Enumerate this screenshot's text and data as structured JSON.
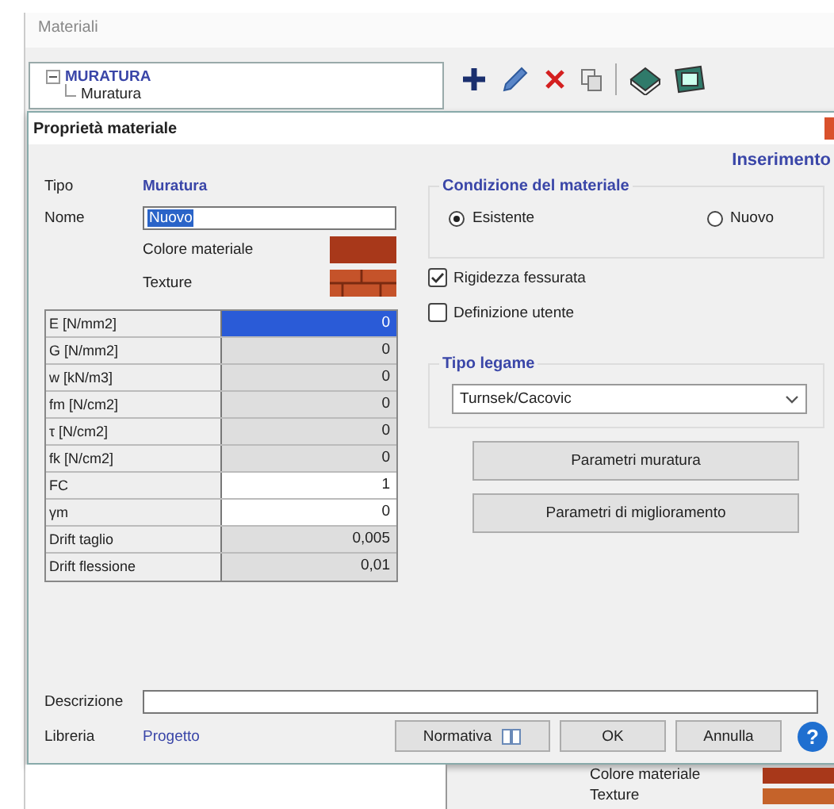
{
  "background_window": {
    "title": "Materiali",
    "tree": [
      {
        "label": "MURATURA",
        "expanded": true,
        "children": [
          {
            "label": "Muratura"
          }
        ]
      }
    ],
    "behind_labels": [
      "Colore materiale",
      "Texture"
    ]
  },
  "dialog": {
    "title": "Proprietà materiale",
    "mode": "Inserimento",
    "tipo": {
      "label": "Tipo",
      "value": "Muratura"
    },
    "nome": {
      "label": "Nome",
      "value": "Nuovo"
    },
    "color_label": "Colore materiale",
    "texture_label": "Texture",
    "properties": [
      {
        "label": "E [N/mm2]",
        "value": "0",
        "selected": true,
        "editable": false
      },
      {
        "label": "G [N/mm2]",
        "value": "0",
        "selected": false,
        "editable": false
      },
      {
        "label": "w [kN/m3]",
        "value": "0",
        "selected": false,
        "editable": false
      },
      {
        "label": "fm [N/cm2]",
        "value": "0",
        "selected": false,
        "editable": false
      },
      {
        "label": "τ [N/cm2]",
        "value": "0",
        "selected": false,
        "editable": false
      },
      {
        "label": "fk [N/cm2]",
        "value": "0",
        "selected": false,
        "editable": false
      },
      {
        "label": "FC",
        "value": "1",
        "selected": false,
        "editable": true
      },
      {
        "label": "γm",
        "value": "0",
        "selected": false,
        "editable": true
      },
      {
        "label": "Drift taglio",
        "value": "0,005",
        "selected": false,
        "editable": false
      },
      {
        "label": "Drift flessione",
        "value": "0,01",
        "selected": false,
        "editable": false
      }
    ],
    "condition": {
      "title": "Condizione del materiale",
      "options": [
        {
          "label": "Esistente",
          "selected": true
        },
        {
          "label": "Nuovo",
          "selected": false
        }
      ]
    },
    "checkboxes": [
      {
        "label": "Rigidezza fessurata",
        "checked": true
      },
      {
        "label": "Definizione utente",
        "checked": false
      }
    ],
    "bond": {
      "title": "Tipo legame",
      "value": "Turnsek/Cacovic"
    },
    "actions": [
      "Parametri muratura",
      "Parametri di miglioramento"
    ],
    "description": {
      "label": "Descrizione"
    },
    "library": {
      "label": "Libreria",
      "value": "Progetto"
    },
    "footer": {
      "normativa": "Normativa",
      "ok": "OK",
      "cancel": "Annulla",
      "help": "?"
    }
  }
}
